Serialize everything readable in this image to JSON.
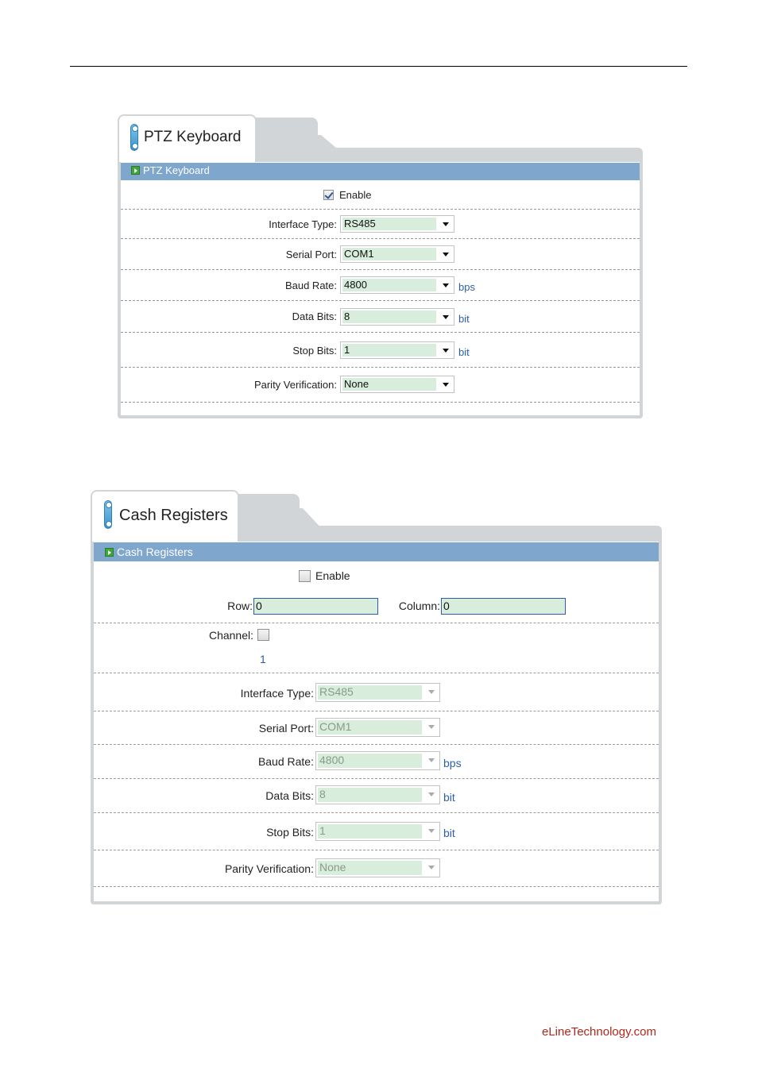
{
  "ptz": {
    "tab_title": "PTZ Keyboard",
    "section_title": "PTZ Keyboard",
    "enable_label": "Enable",
    "enable_checked": true,
    "interface_type_label": "Interface Type:",
    "interface_type_value": "RS485",
    "serial_port_label": "Serial Port:",
    "serial_port_value": "COM1",
    "baud_rate_label": "Baud Rate:",
    "baud_rate_value": "4800",
    "baud_rate_unit": "bps",
    "data_bits_label": "Data Bits:",
    "data_bits_value": "8",
    "data_bits_unit": "bit",
    "stop_bits_label": "Stop Bits:",
    "stop_bits_value": "1",
    "stop_bits_unit": "bit",
    "parity_label": "Parity Verification:",
    "parity_value": "None"
  },
  "cash": {
    "tab_title": "Cash Registers",
    "section_title": "Cash Registers",
    "enable_label": "Enable",
    "enable_checked": false,
    "row_label": "Row:",
    "row_value": "0",
    "column_label": "Column:",
    "column_value": "0",
    "channel_label": "Channel:",
    "channel_number": "1",
    "interface_type_label": "Interface Type:",
    "interface_type_value": "RS485",
    "serial_port_label": "Serial Port:",
    "serial_port_value": "COM1",
    "baud_rate_label": "Baud Rate:",
    "baud_rate_value": "4800",
    "baud_rate_unit": "bps",
    "data_bits_label": "Data Bits:",
    "data_bits_value": "8",
    "data_bits_unit": "bit",
    "stop_bits_label": "Stop Bits:",
    "stop_bits_value": "1",
    "stop_bits_unit": "bit",
    "parity_label": "Parity Verification:",
    "parity_value": "None"
  },
  "footer": {
    "site": "eLineTechnology.com"
  },
  "colors": {
    "header_bar": "#7fa6cc",
    "field_fill": "#d9eddc",
    "unit_text": "#2c5fa8",
    "footer_text": "#b0281e"
  }
}
